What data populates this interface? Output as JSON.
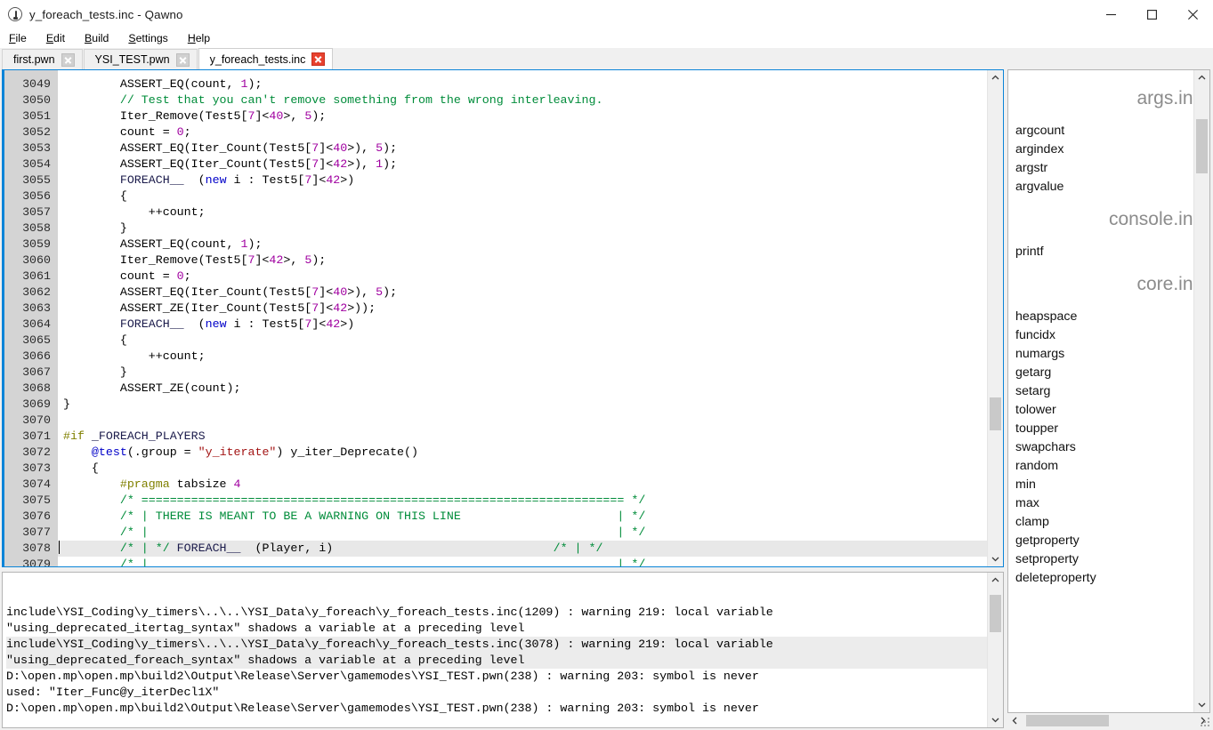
{
  "window": {
    "title": "y_foreach_tests.inc - Qawno",
    "icon": "qawno-app-icon",
    "controls": {
      "minimize": "minimize-icon",
      "maximize": "maximize-icon",
      "close": "close-icon"
    }
  },
  "menubar": {
    "items": [
      {
        "mnemonic": "F",
        "rest": "ile",
        "name": "menu-file"
      },
      {
        "mnemonic": "E",
        "rest": "dit",
        "name": "menu-edit"
      },
      {
        "mnemonic": "B",
        "rest": "uild",
        "name": "menu-build"
      },
      {
        "mnemonic": "S",
        "rest": "ettings",
        "name": "menu-settings"
      },
      {
        "mnemonic": "H",
        "rest": "elp",
        "name": "menu-help"
      }
    ]
  },
  "tabs": [
    {
      "label": "first.pwn",
      "active": false
    },
    {
      "label": "YSI_TEST.pwn",
      "active": false
    },
    {
      "label": "y_foreach_tests.inc",
      "active": true
    }
  ],
  "editor": {
    "first_line_number": 3049,
    "current_line": 3078,
    "caret_line": 3078,
    "scroll": {
      "vertical_thumb_pct": 72,
      "vertical_thumb_size_pct": 7
    },
    "lines": [
      {
        "n": 3049,
        "tokens": [
          {
            "t": "        ASSERT_EQ(count, ",
            "c": "pl"
          },
          {
            "t": "1",
            "c": "num"
          },
          {
            "t": ");",
            "c": "pl"
          }
        ]
      },
      {
        "n": 3050,
        "tokens": [
          {
            "t": "        // Test that you can't remove something from the wrong interleaving.",
            "c": "cmt"
          }
        ]
      },
      {
        "n": 3051,
        "tokens": [
          {
            "t": "        Iter_Remove(Test5[",
            "c": "pl"
          },
          {
            "t": "7",
            "c": "num"
          },
          {
            "t": "]<",
            "c": "pl"
          },
          {
            "t": "40",
            "c": "num"
          },
          {
            "t": ">, ",
            "c": "pl"
          },
          {
            "t": "5",
            "c": "num"
          },
          {
            "t": ");",
            "c": "pl"
          }
        ]
      },
      {
        "n": 3052,
        "tokens": [
          {
            "t": "        count = ",
            "c": "pl"
          },
          {
            "t": "0",
            "c": "num"
          },
          {
            "t": ";",
            "c": "pl"
          }
        ]
      },
      {
        "n": 3053,
        "tokens": [
          {
            "t": "        ASSERT_EQ(Iter_Count(Test5[",
            "c": "pl"
          },
          {
            "t": "7",
            "c": "num"
          },
          {
            "t": "]<",
            "c": "pl"
          },
          {
            "t": "40",
            "c": "num"
          },
          {
            "t": ">), ",
            "c": "pl"
          },
          {
            "t": "5",
            "c": "num"
          },
          {
            "t": ");",
            "c": "pl"
          }
        ]
      },
      {
        "n": 3054,
        "tokens": [
          {
            "t": "        ASSERT_EQ(Iter_Count(Test5[",
            "c": "pl"
          },
          {
            "t": "7",
            "c": "num"
          },
          {
            "t": "]<",
            "c": "pl"
          },
          {
            "t": "42",
            "c": "num"
          },
          {
            "t": ">), ",
            "c": "pl"
          },
          {
            "t": "1",
            "c": "num"
          },
          {
            "t": ");",
            "c": "pl"
          }
        ]
      },
      {
        "n": 3055,
        "tokens": [
          {
            "t": "        ",
            "c": "pl"
          },
          {
            "t": "FOREACH__",
            "c": "id"
          },
          {
            "t": "  (",
            "c": "pl"
          },
          {
            "t": "new",
            "c": "kw"
          },
          {
            "t": " i : Test5[",
            "c": "pl"
          },
          {
            "t": "7",
            "c": "num"
          },
          {
            "t": "]<",
            "c": "pl"
          },
          {
            "t": "42",
            "c": "num"
          },
          {
            "t": ">)",
            "c": "pl"
          }
        ]
      },
      {
        "n": 3056,
        "tokens": [
          {
            "t": "        {",
            "c": "pl"
          }
        ]
      },
      {
        "n": 3057,
        "tokens": [
          {
            "t": "            ++count;",
            "c": "pl"
          }
        ]
      },
      {
        "n": 3058,
        "tokens": [
          {
            "t": "        }",
            "c": "pl"
          }
        ]
      },
      {
        "n": 3059,
        "tokens": [
          {
            "t": "        ASSERT_EQ(count, ",
            "c": "pl"
          },
          {
            "t": "1",
            "c": "num"
          },
          {
            "t": ");",
            "c": "pl"
          }
        ]
      },
      {
        "n": 3060,
        "tokens": [
          {
            "t": "        Iter_Remove(Test5[",
            "c": "pl"
          },
          {
            "t": "7",
            "c": "num"
          },
          {
            "t": "]<",
            "c": "pl"
          },
          {
            "t": "42",
            "c": "num"
          },
          {
            "t": ">, ",
            "c": "pl"
          },
          {
            "t": "5",
            "c": "num"
          },
          {
            "t": ");",
            "c": "pl"
          }
        ]
      },
      {
        "n": 3061,
        "tokens": [
          {
            "t": "        count = ",
            "c": "pl"
          },
          {
            "t": "0",
            "c": "num"
          },
          {
            "t": ";",
            "c": "pl"
          }
        ]
      },
      {
        "n": 3062,
        "tokens": [
          {
            "t": "        ASSERT_EQ(Iter_Count(Test5[",
            "c": "pl"
          },
          {
            "t": "7",
            "c": "num"
          },
          {
            "t": "]<",
            "c": "pl"
          },
          {
            "t": "40",
            "c": "num"
          },
          {
            "t": ">), ",
            "c": "pl"
          },
          {
            "t": "5",
            "c": "num"
          },
          {
            "t": ");",
            "c": "pl"
          }
        ]
      },
      {
        "n": 3063,
        "tokens": [
          {
            "t": "        ASSERT_ZE(Iter_Count(Test5[",
            "c": "pl"
          },
          {
            "t": "7",
            "c": "num"
          },
          {
            "t": "]<",
            "c": "pl"
          },
          {
            "t": "42",
            "c": "num"
          },
          {
            "t": ">));",
            "c": "pl"
          }
        ]
      },
      {
        "n": 3064,
        "tokens": [
          {
            "t": "        ",
            "c": "pl"
          },
          {
            "t": "FOREACH__",
            "c": "id"
          },
          {
            "t": "  (",
            "c": "pl"
          },
          {
            "t": "new",
            "c": "kw"
          },
          {
            "t": " i : Test5[",
            "c": "pl"
          },
          {
            "t": "7",
            "c": "num"
          },
          {
            "t": "]<",
            "c": "pl"
          },
          {
            "t": "42",
            "c": "num"
          },
          {
            "t": ">)",
            "c": "pl"
          }
        ]
      },
      {
        "n": 3065,
        "tokens": [
          {
            "t": "        {",
            "c": "pl"
          }
        ]
      },
      {
        "n": 3066,
        "tokens": [
          {
            "t": "            ++count;",
            "c": "pl"
          }
        ]
      },
      {
        "n": 3067,
        "tokens": [
          {
            "t": "        }",
            "c": "pl"
          }
        ]
      },
      {
        "n": 3068,
        "tokens": [
          {
            "t": "        ASSERT_ZE(count);",
            "c": "pl"
          }
        ]
      },
      {
        "n": 3069,
        "tokens": [
          {
            "t": "}",
            "c": "pl"
          }
        ]
      },
      {
        "n": 3070,
        "tokens": [
          {
            "t": "",
            "c": "pl"
          }
        ]
      },
      {
        "n": 3071,
        "tokens": [
          {
            "t": "#if",
            "c": "pre"
          },
          {
            "t": " _FOREACH_PLAYERS",
            "c": "id"
          }
        ]
      },
      {
        "n": 3072,
        "tokens": [
          {
            "t": "    ",
            "c": "pl"
          },
          {
            "t": "@test",
            "c": "kw"
          },
          {
            "t": "(.group = ",
            "c": "pl"
          },
          {
            "t": "\"y_iterate\"",
            "c": "str"
          },
          {
            "t": ") y_iter_Deprecate()",
            "c": "pl"
          }
        ]
      },
      {
        "n": 3073,
        "tokens": [
          {
            "t": "    {",
            "c": "pl"
          }
        ]
      },
      {
        "n": 3074,
        "tokens": [
          {
            "t": "        ",
            "c": "pl"
          },
          {
            "t": "#pragma",
            "c": "pre"
          },
          {
            "t": " tabsize ",
            "c": "pl"
          },
          {
            "t": "4",
            "c": "num"
          }
        ]
      },
      {
        "n": 3075,
        "tokens": [
          {
            "t": "        /* ==================================================================== */",
            "c": "cmt"
          }
        ]
      },
      {
        "n": 3076,
        "tokens": [
          {
            "t": "        /* | THERE IS MEANT TO BE A WARNING ON THIS LINE                      | */",
            "c": "cmt"
          }
        ]
      },
      {
        "n": 3077,
        "tokens": [
          {
            "t": "        /* |                                                                  | */",
            "c": "cmt"
          }
        ]
      },
      {
        "n": 3078,
        "tokens": [
          {
            "t": "        /* | */ ",
            "c": "cmt"
          },
          {
            "t": "FOREACH__",
            "c": "id"
          },
          {
            "t": "  (Player, i)                               ",
            "c": "pl"
          },
          {
            "t": "/* | */",
            "c": "cmt"
          }
        ]
      },
      {
        "n": 3079,
        "tokens": [
          {
            "t": "        /* |                                                                  | */",
            "c": "cmt"
          }
        ]
      }
    ]
  },
  "output": {
    "highlighted_line_indexes": [
      2,
      3
    ],
    "lines": [
      "include\\YSI_Coding\\y_timers\\..\\..\\YSI_Data\\y_foreach\\y_foreach_tests.inc(1209) : warning 219: local variable",
      "\"using_deprecated_itertag_syntax\" shadows a variable at a preceding level",
      "include\\YSI_Coding\\y_timers\\..\\..\\YSI_Data\\y_foreach\\y_foreach_tests.inc(3078) : warning 219: local variable",
      "\"using_deprecated_foreach_syntax\" shadows a variable at a preceding level",
      "D:\\open.mp\\open.mp\\build2\\Output\\Release\\Server\\gamemodes\\YSI_TEST.pwn(238) : warning 203: symbol is never",
      "used: \"Iter_Func@y_iterDecl1X\"",
      "D:\\open.mp\\open.mp\\build2\\Output\\Release\\Server\\gamemodes\\YSI_TEST.pwn(238) : warning 203: symbol is never"
    ],
    "scroll": {
      "vertical_thumb_pct": 8,
      "vertical_thumb_size_pct": 30
    }
  },
  "sidebar": {
    "scroll": {
      "vertical_thumb_pct": 6,
      "vertical_thumb_size_pct": 9,
      "horizontal_thumb_pct": 4,
      "horizontal_thumb_size_pct": 48
    },
    "entries": [
      {
        "type": "group",
        "label": "args.inc"
      },
      {
        "type": "item",
        "label": "argcount"
      },
      {
        "type": "item",
        "label": "argindex"
      },
      {
        "type": "item",
        "label": "argstr"
      },
      {
        "type": "item",
        "label": "argvalue"
      },
      {
        "type": "group",
        "label": "console.inc"
      },
      {
        "type": "item",
        "label": "printf"
      },
      {
        "type": "group",
        "label": "core.inc"
      },
      {
        "type": "item",
        "label": "heapspace"
      },
      {
        "type": "item",
        "label": "funcidx"
      },
      {
        "type": "item",
        "label": "numargs"
      },
      {
        "type": "item",
        "label": "getarg"
      },
      {
        "type": "item",
        "label": "setarg"
      },
      {
        "type": "item",
        "label": "tolower"
      },
      {
        "type": "item",
        "label": "toupper"
      },
      {
        "type": "item",
        "label": "swapchars"
      },
      {
        "type": "item",
        "label": "random"
      },
      {
        "type": "item",
        "label": "min"
      },
      {
        "type": "item",
        "label": "max"
      },
      {
        "type": "item",
        "label": "clamp"
      },
      {
        "type": "item",
        "label": "getproperty"
      },
      {
        "type": "item",
        "label": "setproperty"
      },
      {
        "type": "item",
        "label": "deleteproperty"
      }
    ]
  },
  "colors": {
    "accent_focus_border": "#0a84d8",
    "gutter_bg": "#d4d4d4",
    "current_line_bg": "#e8e8e8",
    "comment": "#008c3a",
    "keyword": "#0000c8",
    "number": "#a000a0",
    "string": "#a31515",
    "preprocessor": "#808000",
    "tab_close_active": "#e8412e"
  }
}
